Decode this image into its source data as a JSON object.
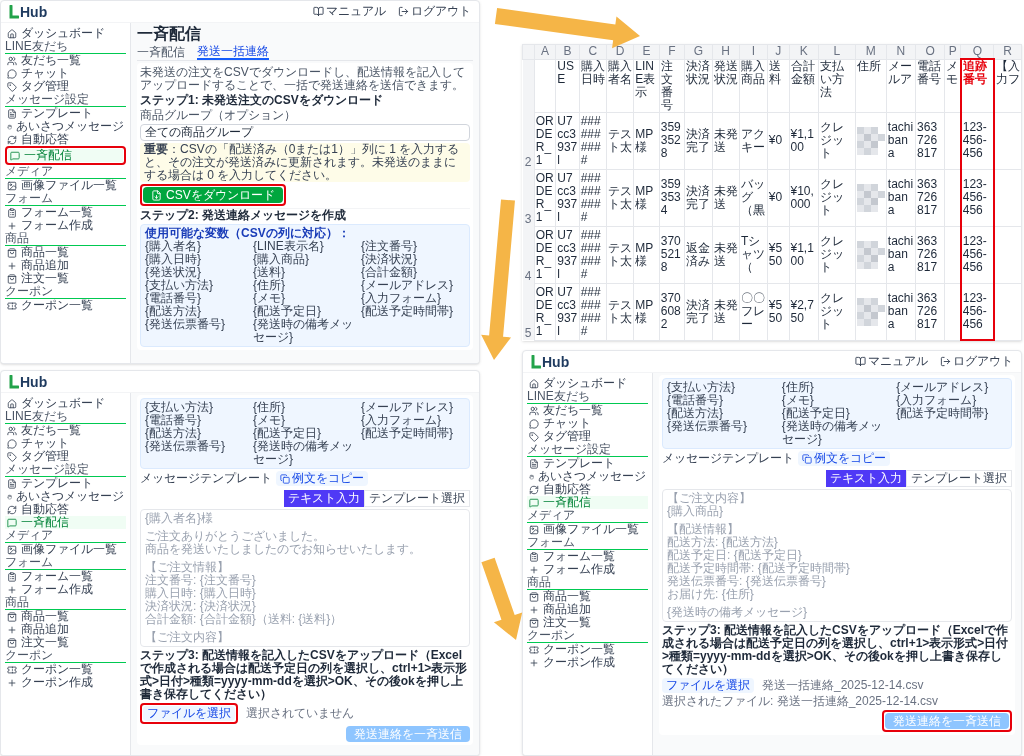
{
  "screen_1": {
    "logo_text": "Hub",
    "header_links": [
      "マニュアル",
      "ログアウト"
    ],
    "sidebar": [
      {
        "items": [
          {
            "label": "ダッシュボード",
            "selected": false,
            "highlighted": false
          }
        ]
      },
      {
        "heading": "LINE友だち",
        "items": [
          {
            "label": "友だち一覧",
            "selected": false,
            "highlighted": false
          },
          {
            "label": "チャット",
            "selected": false,
            "highlighted": false
          },
          {
            "label": "タグ管理",
            "selected": false,
            "highlighted": false
          }
        ]
      },
      {
        "heading": "メッセージ設定",
        "items": [
          {
            "label": "テンプレート",
            "selected": false,
            "highlighted": false
          },
          {
            "label": "あいさつメッセージ",
            "selected": false,
            "highlighted": false
          },
          {
            "label": "自動応答",
            "selected": false,
            "highlighted": false
          },
          {
            "label": "一斉配信",
            "selected": true,
            "highlighted": true
          }
        ]
      },
      {
        "heading": "メディア",
        "items": [
          {
            "label": "画像ファイル一覧",
            "selected": false,
            "highlighted": false
          }
        ]
      },
      {
        "heading": "フォーム",
        "items": [
          {
            "label": "フォーム一覧",
            "selected": false,
            "highlighted": false
          },
          {
            "label": "フォーム作成",
            "selected": false,
            "highlighted": false
          }
        ]
      },
      {
        "heading": "商品",
        "items": [
          {
            "label": "商品一覧",
            "selected": false,
            "highlighted": false
          },
          {
            "label": "商品追加",
            "selected": false,
            "highlighted": false
          },
          {
            "label": "注文一覧",
            "selected": false,
            "highlighted": false
          }
        ]
      },
      {
        "heading": "クーポン",
        "items": [
          {
            "label": "クーポン一覧",
            "selected": false,
            "highlighted": false
          }
        ]
      }
    ],
    "title": "一斉配信",
    "tabs": [
      {
        "label": "一斉配信",
        "selected": false
      },
      {
        "label": "発送一括連絡",
        "selected": true
      }
    ],
    "description": "未発送の注文をCSVでダウンロードし、配送情報を記入してアップロードすることで、一括で発送連絡を送信できます。",
    "step_1": "ステップ1: 未発送注文のCSVをダウンロード",
    "group_select": {
      "label": "商品グループ（オプション）",
      "value": "全ての商品グループ"
    },
    "warning": "**重要**：CSVの「配送済み（0または1）」列に 1 を入力すると、その注文が発送済みに更新されます。未発送のままにする場合は 0 を入力してください。",
    "download_button": {
      "label": "CSVをダウンロード",
      "highlighted": true
    },
    "step_2": "ステップ2: 発送連絡メッセージを作成",
    "variables": {
      "title": "使用可能な変数（CSVの列に対応）：",
      "items": [
        "{購入者名}",
        "{LINE表示名}",
        "{注文番号}",
        "{購入日時}",
        "{購入商品}",
        "{決済状況}",
        "{発送状況}",
        "{送料}",
        "{合計金額}",
        "{支払い方法}",
        "{住所}",
        "{メールアドレス}",
        "{電話番号}",
        "{メモ}",
        "{入力フォーム}",
        "{配送方法}",
        "{配送予定日}",
        "{配送予定時間帯}",
        "{発送伝票番号}",
        "{発送時の備考メッセージ}"
      ]
    }
  },
  "spreadsheet": {
    "columns": [
      {
        "letter": "A",
        "kind": "text"
      },
      {
        "letter": "B",
        "header": "USE",
        "kind": "text"
      },
      {
        "letter": "C",
        "header": "購入日時",
        "kind": "text"
      },
      {
        "letter": "D",
        "header": "購入者名",
        "kind": "text"
      },
      {
        "letter": "E",
        "header": "LINE表示",
        "kind": "text"
      },
      {
        "letter": "F",
        "header": "注文番号",
        "kind": "text"
      },
      {
        "letter": "G",
        "header": "決済状況",
        "kind": "text"
      },
      {
        "letter": "H",
        "header": "発送状況",
        "kind": "text"
      },
      {
        "letter": "I",
        "header": "購入商品",
        "kind": "text"
      },
      {
        "letter": "J",
        "header": "送料",
        "kind": "text"
      },
      {
        "letter": "K",
        "header": "合計金額",
        "kind": "text"
      },
      {
        "letter": "L",
        "header": "支払い方法",
        "kind": "text"
      },
      {
        "letter": "M",
        "header": "住所",
        "kind": "blurred"
      },
      {
        "letter": "N",
        "header": "メールア",
        "kind": "text"
      },
      {
        "letter": "O",
        "header": "電話番号",
        "kind": "text"
      },
      {
        "letter": "P",
        "header": "メモ",
        "kind": "text"
      },
      {
        "letter": "Q",
        "header": "追跡番号",
        "kind": "text",
        "highlighted": true
      },
      {
        "letter": "R",
        "header": "【入力フ",
        "kind": "text"
      }
    ],
    "rows": [
      {
        "number": "2",
        "cells": [
          "ORDER_1",
          "U7cc3937l",
          "##########",
          "テスト太",
          "MP 様",
          "3593528",
          "決済完了",
          "未発送",
          "アクキー",
          "¥0",
          "¥1,100",
          "クレジット",
          null,
          "tachibana",
          "363726817",
          null,
          "123-456-456",
          null
        ]
      },
      {
        "number": "3",
        "cells": [
          "ORDER_1",
          "U7cc3937l",
          "##########",
          "テスト太",
          "MP 様",
          "3593534",
          "決済完了",
          "未発送",
          "バッグ（黒",
          "¥0",
          "¥10,000",
          "クレジット",
          null,
          "tachibana",
          "363726817",
          null,
          "123-456-456",
          null
        ]
      },
      {
        "number": "4",
        "cells": [
          "ORDER_1",
          "U7cc3937l",
          "##########",
          "テスト太",
          "MP 様",
          "3705218",
          "返金済み",
          "未発送",
          "Tシャツ（",
          "¥550",
          "¥1,100",
          "クレジット",
          null,
          "tachibana",
          "363726817",
          null,
          "123-456-456",
          null
        ]
      },
      {
        "number": "5",
        "cells": [
          "ORDER_1",
          "U7cc3937l",
          "##########",
          "テスト太",
          "MP 様",
          "3706082",
          "決済完了",
          "未発送",
          "〇〇フレー",
          "¥550",
          "¥2,750",
          "クレジット",
          null,
          "tachibana",
          "363726817",
          null,
          "123-456-456",
          null
        ]
      }
    ]
  },
  "screen_2": {
    "logo_text": "Hub",
    "sidebar": [
      {
        "items": [
          {
            "label": "ダッシュボード",
            "selected": false
          }
        ]
      },
      {
        "heading": "LINE友だち",
        "items": [
          {
            "label": "友だち一覧",
            "selected": false
          },
          {
            "label": "チャット",
            "selected": false
          },
          {
            "label": "タグ管理",
            "selected": false
          }
        ]
      },
      {
        "heading": "メッセージ設定",
        "items": [
          {
            "label": "テンプレート",
            "selected": false
          },
          {
            "label": "あいさつメッセージ",
            "selected": false
          },
          {
            "label": "自動応答",
            "selected": false
          },
          {
            "label": "一斉配信",
            "selected": true
          }
        ]
      },
      {
        "heading": "メディア",
        "items": [
          {
            "label": "画像ファイル一覧",
            "selected": false
          }
        ]
      },
      {
        "heading": "フォーム",
        "items": [
          {
            "label": "フォーム一覧",
            "selected": false
          },
          {
            "label": "フォーム作成",
            "selected": false
          }
        ]
      },
      {
        "heading": "商品",
        "items": [
          {
            "label": "商品一覧",
            "selected": false
          },
          {
            "label": "商品追加",
            "selected": false
          },
          {
            "label": "注文一覧",
            "selected": false
          }
        ]
      },
      {
        "heading": "クーポン",
        "items": [
          {
            "label": "クーポン一覧",
            "selected": false
          },
          {
            "label": "クーポン作成",
            "selected": false
          }
        ]
      }
    ],
    "variables": {
      "items": [
        "{支払い方法}",
        "{住所}",
        "{メールアドレス}",
        "{電話番号}",
        "{メモ}",
        "{入力フォーム}",
        "{配送方法}",
        "{配送予定日}",
        "{配送予定時間帯}",
        "{発送伝票番号}",
        "{発送時の備考メッセージ}"
      ]
    },
    "template_label": "メッセージテンプレート",
    "copy_button": "例文をコピー",
    "mode_toggle": [
      {
        "label": "テキスト入力",
        "selected": true
      },
      {
        "label": "テンプレート選択",
        "selected": false
      }
    ],
    "message_field": {
      "placeholder_blocks": [
        [
          "{購入者名}様"
        ],
        [
          "ご注文ありがとうございました。",
          "商品を発送いたしましたのでお知らせいたします。"
        ],
        [
          "【ご注文情報】",
          "注文番号: {注文番号}",
          "購入日時: {購入日時}",
          "決済状況: {決済状況}",
          "合計金額: {合計金額}（送料: {送料}）"
        ],
        [
          "【ご注文内容】"
        ]
      ]
    },
    "step_3": "ステップ3: 配送情報を記入したCSVをアップロード（Excelで作成される場合は配送予定日の列を選択し、ctrl+1>表示形式>日付>種類=yyyy-mm-ddを選択>OK、その後okを押し上書き保存してください）",
    "file_button": {
      "label": "ファイルを選択",
      "highlighted": true
    },
    "file_status": "選択されていません",
    "send_button": {
      "label": "発送連絡を一斉送信",
      "disabled": true,
      "highlighted": false
    }
  },
  "screen_3": {
    "logo_text": "Hub",
    "header_links": [
      "マニュアル",
      "ログアウト"
    ],
    "sidebar": [
      {
        "items": [
          {
            "label": "ダッシュボード",
            "selected": false
          }
        ]
      },
      {
        "heading": "LINE友だち",
        "items": [
          {
            "label": "友だち一覧",
            "selected": false
          },
          {
            "label": "チャット",
            "selected": false
          },
          {
            "label": "タグ管理",
            "selected": false
          }
        ]
      },
      {
        "heading": "メッセージ設定",
        "items": [
          {
            "label": "テンプレート",
            "selected": false
          },
          {
            "label": "あいさつメッセージ",
            "selected": false
          },
          {
            "label": "自動応答",
            "selected": false
          },
          {
            "label": "一斉配信",
            "selected": true
          }
        ]
      },
      {
        "heading": "メディア",
        "items": [
          {
            "label": "画像ファイル一覧",
            "selected": false
          }
        ]
      },
      {
        "heading": "フォーム",
        "items": [
          {
            "label": "フォーム一覧",
            "selected": false
          },
          {
            "label": "フォーム作成",
            "selected": false
          }
        ]
      },
      {
        "heading": "商品",
        "items": [
          {
            "label": "商品一覧",
            "selected": false
          },
          {
            "label": "商品追加",
            "selected": false
          },
          {
            "label": "注文一覧",
            "selected": false
          }
        ]
      },
      {
        "heading": "クーポン",
        "items": [
          {
            "label": "クーポン一覧",
            "selected": false
          },
          {
            "label": "クーポン作成",
            "selected": false
          }
        ]
      }
    ],
    "variables": {
      "items": [
        "{支払い方法}",
        "{住所}",
        "{メールアドレス}",
        "{電話番号}",
        "{メモ}",
        "{入力フォーム}",
        "{配送方法}",
        "{配送予定日}",
        "{配送予定時間帯}",
        "{発送伝票番号}",
        "{発送時の備考メッセージ}"
      ]
    },
    "template_label": "メッセージテンプレート",
    "copy_button": "例文をコピー",
    "mode_toggle": [
      {
        "label": "テキスト入力",
        "selected": true
      },
      {
        "label": "テンプレート選択",
        "selected": false
      }
    ],
    "message_field": {
      "placeholder_blocks": [
        [
          "【ご注文内容】",
          "{購入商品}"
        ],
        [
          "【配送情報】",
          "配送方法: {配送方法}",
          "配送予定日: {配送予定日}",
          "配送予定時間帯: {配送予定時間帯}",
          "発送伝票番号: {発送伝票番号}",
          "お届け先: {住所}"
        ],
        [
          "{発送時の備考メッセージ}"
        ]
      ]
    },
    "step_3": "ステップ3: 配送情報を記入したCSVをアップロード（Excelで作成される場合は配送予定日の列を選択し、ctrl+1>表示形式>日付>種類=yyyy-mm-ddを選択>OK、その後okを押し上書き保存してください）",
    "file_button": {
      "label": "ファイルを選択",
      "highlighted": false
    },
    "file_status": "発送一括連絡_2025-12-14.csv",
    "selected_file": "選択されたファイル: 発送一括連絡_2025-12-14.csv",
    "send_button": {
      "label": "発送連絡を一斉送信",
      "disabled": true,
      "highlighted": true
    }
  }
}
